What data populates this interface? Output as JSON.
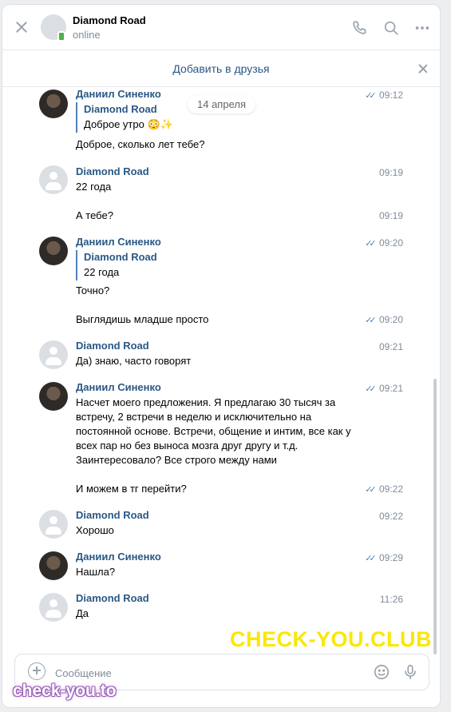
{
  "header": {
    "peer_name": "Diamond Road",
    "peer_status": "online"
  },
  "friend_bar": {
    "label": "Добавить в друзья"
  },
  "date_separator": "14 апреля",
  "messages": [
    {
      "author": "Даниил Синенко",
      "time": "09:12",
      "read": true,
      "reply": {
        "author": "Diamond Road",
        "text": "Доброе утро 😳✨"
      },
      "text": "Доброе, сколько лет тебе?"
    },
    {
      "author": "Diamond Road",
      "time": "09:19",
      "text": "22 года"
    },
    {
      "time": "09:19",
      "text": "А тебе?"
    },
    {
      "author": "Даниил Синенко",
      "time": "09:20",
      "read": true,
      "reply": {
        "author": "Diamond Road",
        "text": "22 года"
      },
      "text": "Точно?"
    },
    {
      "time": "09:20",
      "read": true,
      "text": "Выглядишь младше просто"
    },
    {
      "author": "Diamond Road",
      "time": "09:21",
      "text": "Да) знаю, часто говорят"
    },
    {
      "author": "Даниил Синенко",
      "time": "09:21",
      "read": true,
      "lines": [
        "Насчет моего предложения. Я предлагаю 30 тысяч за",
        "встречу, 2 встречи в неделю и исключительно на",
        "постоянной основе. Встречи, общение и интим, все как у",
        "всех пар но без выноса мозга друг другу и т.д.",
        "Заинтересовало? Все строго между нами"
      ]
    },
    {
      "time": "09:22",
      "read": true,
      "text": "И можем в тг перейти?"
    },
    {
      "author": "Diamond Road",
      "time": "09:22",
      "text": "Хорошо"
    },
    {
      "author": "Даниил Синенко",
      "time": "09:29",
      "read": true,
      "text": "Нашла?"
    },
    {
      "author": "Diamond Road",
      "time": "11:26",
      "text": "Да"
    }
  ],
  "composer": {
    "placeholder": "Сообщение"
  },
  "watermarks": {
    "big": "CHECK-YOU.CLUB",
    "small": "check-you.to"
  },
  "colors": {
    "link": "#2a5885",
    "accent": "#5181b8",
    "muted": "#818c99",
    "online": "#4bb34b",
    "watermark_yellow": "#fbe700"
  }
}
